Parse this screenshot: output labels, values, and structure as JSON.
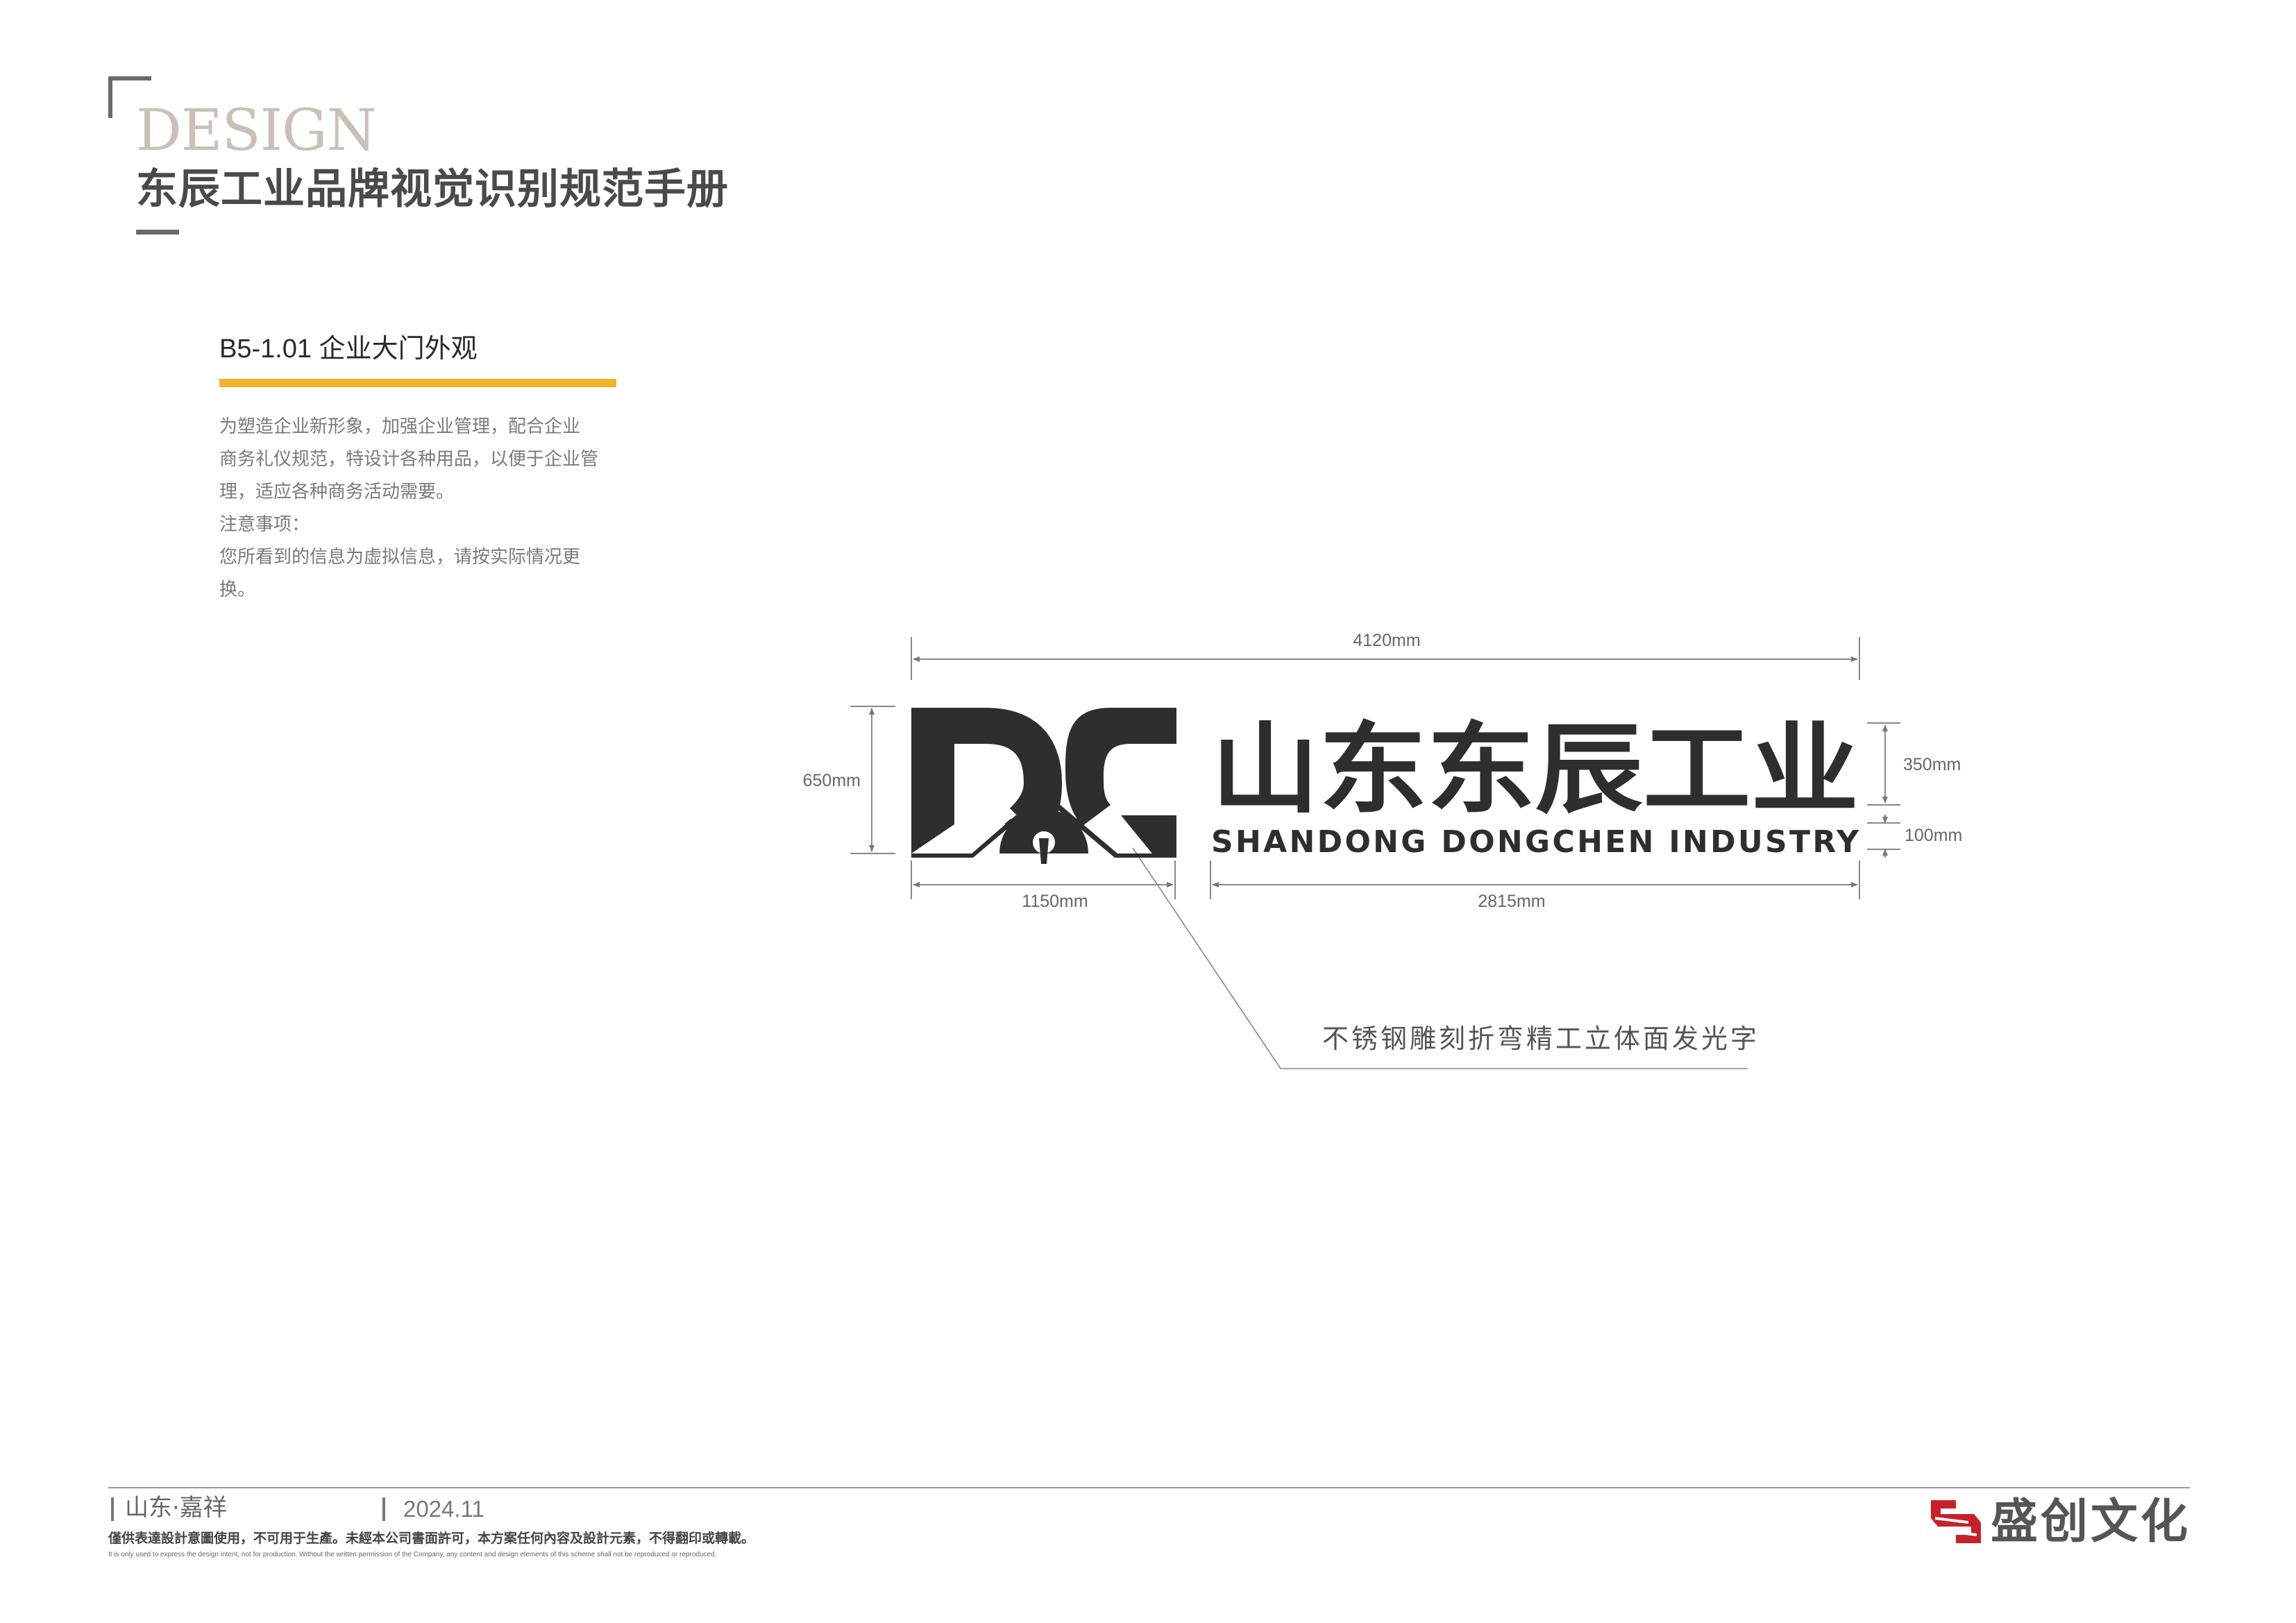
{
  "header": {
    "design_word": "DESIGN",
    "manual_title": "东辰工业品牌视觉识别规范手册"
  },
  "section": {
    "code_title": "B5-1.01  企业大门外观",
    "accent_color": "#f0b428",
    "description_lines": [
      "为塑造企业新形象，加强企业管理，配合企业",
      "商务礼仪规范，特设计各种用品，以便于企业管",
      "理，适应各种商务活动需要。",
      "注意事项：",
      "您所看到的信息为虚拟信息，请按实际情况更",
      "换。"
    ]
  },
  "drawing": {
    "logo_mark": "DC",
    "company_cn": "山东东辰工业",
    "company_en": "SHANDONG DONGCHEN INDUSTRY",
    "logo_color": "#2e2e2e",
    "dimensions": {
      "total_width": "4120mm",
      "height": "650mm",
      "mark_width": "1150mm",
      "text_width": "2815mm",
      "cn_height": "350mm",
      "en_height": "100mm"
    },
    "material_note": "不锈钢雕刻折弯精工立体面发光字"
  },
  "footer": {
    "location": "山东·嘉祥",
    "date": "2024.11",
    "disclaimer_cn": "僅供表達設計意圖使用，不可用于生產。未經本公司書面許可，本方案任何內容及設計元素，不得翻印或轉載。",
    "disclaimer_en": "It is only used to express the design intent, not for production. Without the written permission of the Company, any content and design elements of this scheme shall not be reproduced or reproduced.",
    "brand": "盛创文化",
    "brand_color": "#c8202a"
  }
}
